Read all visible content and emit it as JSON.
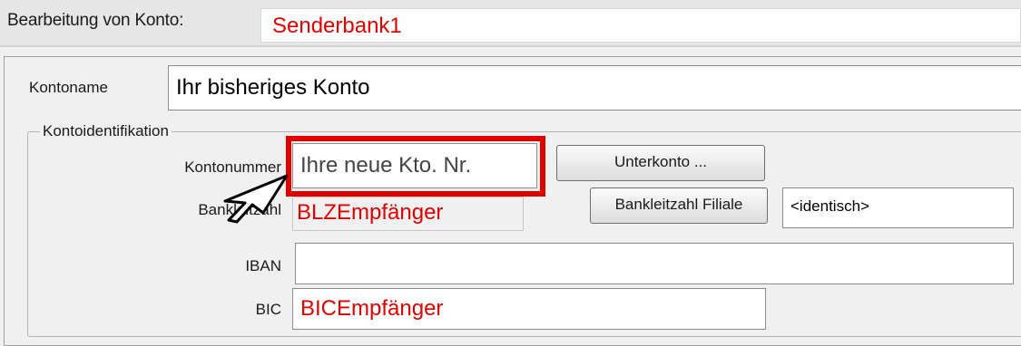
{
  "header": {
    "label": "Bearbeitung von Konto:",
    "account": "Senderbank1"
  },
  "form": {
    "kontoname_label": "Kontoname",
    "kontoname_value": "Ihr bisheriges Konto",
    "group_title": "Kontoidentifikation",
    "kontonummer_label": "Kontonummer",
    "kontonummer_value": "Ihre neue Kto. Nr.",
    "unterkonto_button": "Unterkonto ...",
    "bankleitzahl_label": "Bankleitzahl",
    "bankleitzahl_value": "BLZEmpfänger",
    "bankleitzahl_filiale_button": "Bankleitzahl Filiale",
    "filiale_value": "<identisch>",
    "iban_label": "IBAN",
    "iban_value": "",
    "bic_label": "BIC",
    "bic_value": "BICEmpfänger"
  },
  "colors": {
    "highlight": "#e00000",
    "value_text": "#e00000"
  },
  "icons": {
    "pointer": "pointer-arrow-icon"
  }
}
